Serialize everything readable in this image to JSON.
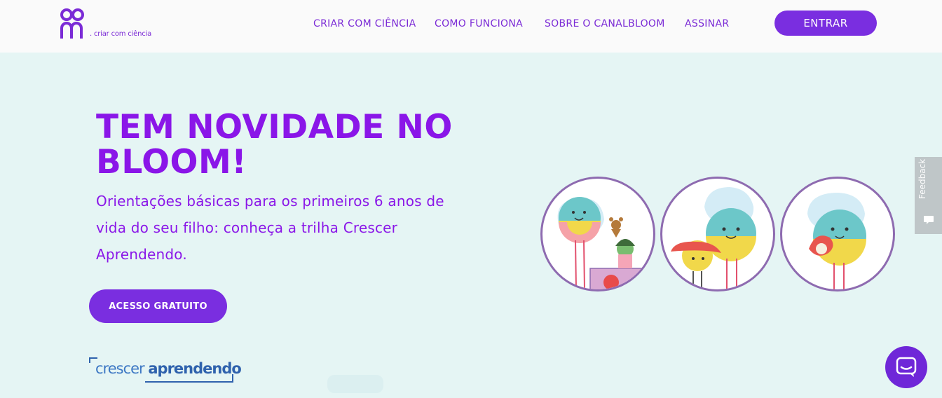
{
  "header": {
    "logo_text": ". criar com ciência",
    "nav": [
      {
        "label": "CRIAR COM CIÊNCIA"
      },
      {
        "label": "COMO FUNCIONA"
      },
      {
        "label": "SOBRE O CANALBLOOM"
      },
      {
        "label": "ASSINAR"
      }
    ],
    "login_label": "ENTRAR"
  },
  "hero": {
    "title": "TEM NOVIDADE NO BLOOM!",
    "subtitle": "Orientações básicas para os primeiros 6 anos de vida do seu filho: conheça a trilha Crescer Aprendendo.",
    "cta_label": "ACESSO GRATUITO"
  },
  "brand_logo": {
    "part1": "crescer ",
    "part2": "aprendendo"
  },
  "feedback_tab": {
    "label": "Feedback"
  },
  "colors": {
    "accent": "#7a2ee0",
    "title": "#8a16e8",
    "background": "#e5f5f4",
    "header": "#fafafa"
  }
}
